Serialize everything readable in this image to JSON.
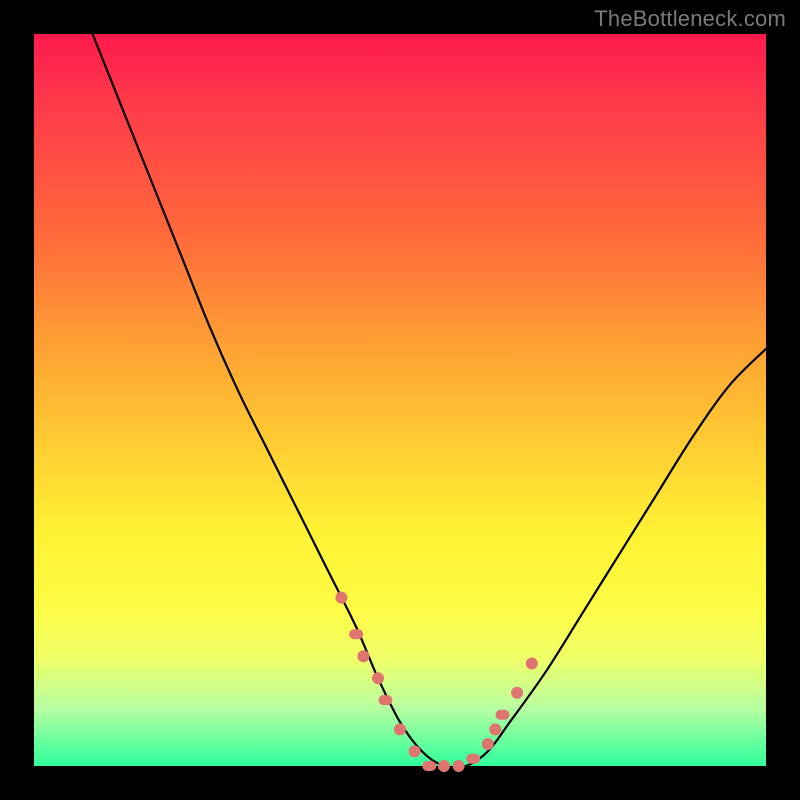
{
  "watermark": "TheBottleneck.com",
  "chart_data": {
    "type": "line",
    "title": "",
    "xlabel": "",
    "ylabel": "",
    "xlim": [
      0,
      100
    ],
    "ylim": [
      0,
      100
    ],
    "series": [
      {
        "name": "bottleneck-curve",
        "x": [
          8,
          12,
          16,
          20,
          24,
          28,
          32,
          36,
          40,
          44,
          47,
          50,
          53,
          56,
          59,
          62,
          65,
          70,
          75,
          80,
          85,
          90,
          95,
          100
        ],
        "values": [
          100,
          90,
          80,
          70,
          60,
          51,
          43,
          35,
          27,
          19,
          12,
          6,
          2,
          0,
          0,
          2,
          6,
          13,
          21,
          29,
          37,
          45,
          52,
          57
        ]
      }
    ],
    "markers": {
      "name": "highlighted-points",
      "color": "#e0746e",
      "x": [
        42,
        44,
        45,
        47,
        48,
        50,
        52,
        54,
        56,
        58,
        60,
        62,
        63,
        64,
        66,
        68
      ],
      "values": [
        23,
        18,
        15,
        12,
        9,
        5,
        2,
        0,
        0,
        0,
        1,
        3,
        5,
        7,
        10,
        14
      ]
    }
  }
}
